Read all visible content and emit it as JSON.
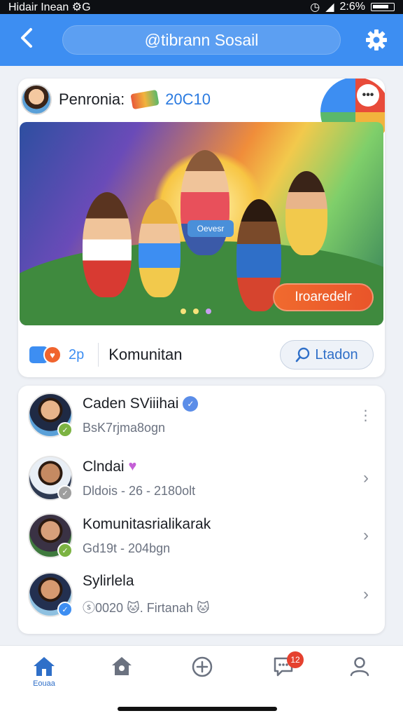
{
  "status_bar": {
    "left_text": "Hidair Inean ⚙G",
    "right_text": "2:6%"
  },
  "header": {
    "title": "@tibrann Sosail"
  },
  "featured": {
    "poster_name": "Penronia:",
    "poster_count": "20C10",
    "banner_label": "Oevesr",
    "join_label": "Iroaredelr",
    "reaction_count": "2p",
    "community_label": "Komunitan",
    "follow_label": "Ltadon",
    "more_label": "•••"
  },
  "list": [
    {
      "name": "Caden SViiihai",
      "sub": "BsK7rjma8ogn",
      "badge": "verified",
      "action": "more",
      "avatar_color": "#e8b48a",
      "bg": "#5aa0d8",
      "status_color": "#7cb342"
    },
    {
      "name": "Clndai",
      "sub": "Dldois - 26 - 2180olt",
      "badge": "heart",
      "action": "chevron",
      "avatar_color": "#c58a62",
      "bg": "#2e3a52",
      "status_color": "#9e9e9e"
    },
    {
      "name": "Komunitasrialikarak",
      "sub": "Gd19t - 204bgn",
      "badge": "none",
      "action": "chevron",
      "avatar_color": "#d8a07a",
      "bg": "#3f7a3e",
      "status_color": "#7cb342"
    },
    {
      "name": "Sylirlela",
      "sub": "ⓢ0020 🐱. Firtanah 🐱",
      "badge": "none",
      "action": "chevron",
      "avatar_color": "#d69a70",
      "bg": "#8ec0e0",
      "status_color": "#3d8ef2"
    }
  ],
  "nav": {
    "home_label": "Eouaa",
    "notif_count": "12"
  },
  "colors": {
    "accent": "#3d8ef2",
    "cta": "#f06a2e"
  }
}
